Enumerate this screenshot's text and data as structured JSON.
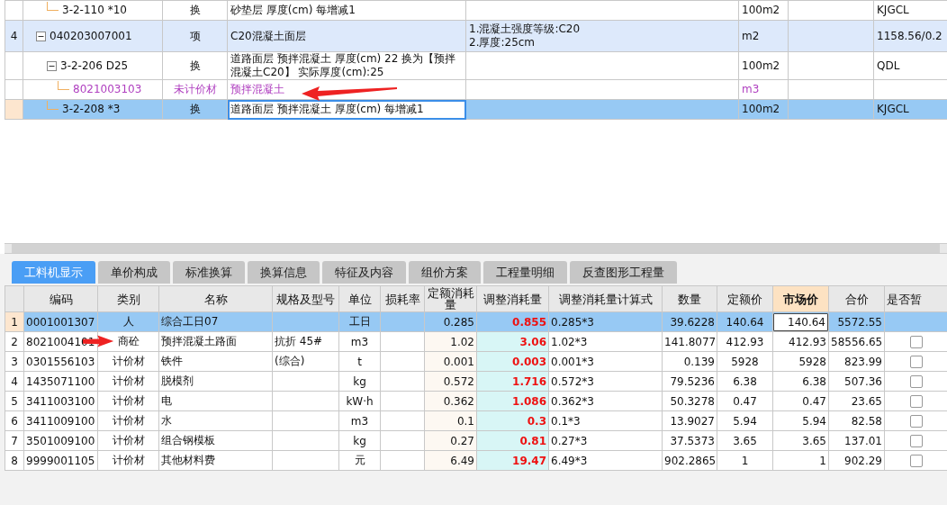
{
  "upper_grid": {
    "rows": [
      {
        "kind": "quota",
        "code": "3-2-110 *10",
        "type": "换",
        "name": "砂垫层 厚度(cm) 每增减1",
        "unit": "100m2",
        "column_8": "KJGCL",
        "selected": false
      },
      {
        "kind": "item",
        "number": "4",
        "code": "040203007001",
        "type": "项",
        "name": "C20混凝土面层",
        "features": [
          "1.混凝土强度等级:C20",
          "2.厚度:25cm"
        ],
        "unit": "m2",
        "column_8": "1158.56/0.2",
        "expanded": true,
        "selected": false,
        "children": [
          {
            "kind": "quota",
            "code": "3-2-206 D25",
            "type": "换",
            "name": "道路面层 预拌混凝土 厚度(cm) 22  换为【预拌混凝土C20】  实际厚度(cm):25",
            "unit": "100m2",
            "column_8": "QDL",
            "expanded": true,
            "selected": false,
            "children": [
              {
                "kind": "material",
                "code": "8021003103",
                "type": "未计价材",
                "name": "预拌混凝土",
                "unit": "m3",
                "selected": false
              }
            ]
          },
          {
            "kind": "quota",
            "code": "3-2-208 *3",
            "type": "换",
            "name": "道路面层 预拌混凝土 厚度(cm) 每增减1",
            "unit": "100m2",
            "column_8": "KJGCL",
            "selected": true
          }
        ]
      }
    ]
  },
  "tabs": [
    {
      "label": "工料机显示",
      "selected": true
    },
    {
      "label": "单价构成",
      "selected": false
    },
    {
      "label": "标准换算",
      "selected": false
    },
    {
      "label": "换算信息",
      "selected": false
    },
    {
      "label": "特征及内容",
      "selected": false
    },
    {
      "label": "组价方案",
      "selected": false
    },
    {
      "label": "工程量明细",
      "selected": false
    },
    {
      "label": "反查图形工程量",
      "selected": false
    }
  ],
  "lower_grid": {
    "columns": [
      {
        "label": "编码",
        "selected": false
      },
      {
        "label": "类别",
        "selected": false
      },
      {
        "label": "名称",
        "selected": false
      },
      {
        "label": "规格及型号",
        "selected": false
      },
      {
        "label": "单位",
        "selected": false
      },
      {
        "label": "损耗率",
        "selected": false
      },
      {
        "label": "定额消耗量",
        "selected": false
      },
      {
        "label": "调整消耗量",
        "selected": false
      },
      {
        "label": "调整消耗量计算式",
        "selected": false
      },
      {
        "label": "数量",
        "selected": false
      },
      {
        "label": "定额价",
        "selected": false
      },
      {
        "label": "市场价",
        "selected": true
      },
      {
        "label": "合价",
        "selected": false
      },
      {
        "label": "是否暂",
        "selected": false
      }
    ],
    "rows": [
      {
        "number": "1",
        "code": "0001001307",
        "type": "人",
        "name": "综合工日07",
        "unit": "工日",
        "quota_qty": "0.285",
        "adjusted_qty": "0.855",
        "formula": "0.285*3",
        "quantity": "39.6228",
        "quota_price": "140.64",
        "market_price": "140.64",
        "total": "5572.55",
        "selected": true
      },
      {
        "number": "2",
        "code": "8021004101",
        "type": "商砼",
        "name": "预拌混凝土路面",
        "spec": "抗折 45#",
        "unit": "m3",
        "quota_qty": "1.02",
        "adjusted_qty": "3.06",
        "formula": "1.02*3",
        "quantity": "141.8077",
        "quota_price": "412.93",
        "market_price": "412.93",
        "total": "58556.65",
        "checked": false,
        "selected": false
      },
      {
        "number": "3",
        "code": "0301556103",
        "type": "计价材",
        "name": "铁件",
        "spec": "(综合)",
        "unit": "t",
        "quota_qty": "0.001",
        "adjusted_qty": "0.003",
        "formula": "0.001*3",
        "quantity": "0.139",
        "quota_price": "5928",
        "market_price": "5928",
        "total": "823.99",
        "checked": false,
        "selected": false
      },
      {
        "number": "4",
        "code": "1435071100",
        "type": "计价材",
        "name": "脱模剂",
        "unit": "kg",
        "quota_qty": "0.572",
        "adjusted_qty": "1.716",
        "formula": "0.572*3",
        "quantity": "79.5236",
        "quota_price": "6.38",
        "market_price": "6.38",
        "total": "507.36",
        "checked": false,
        "selected": false
      },
      {
        "number": "5",
        "code": "3411003100",
        "type": "计价材",
        "name": "电",
        "unit": "kW·h",
        "quota_qty": "0.362",
        "adjusted_qty": "1.086",
        "formula": "0.362*3",
        "quantity": "50.3278",
        "quota_price": "0.47",
        "market_price": "0.47",
        "total": "23.65",
        "checked": false,
        "selected": false
      },
      {
        "number": "6",
        "code": "3411009100",
        "type": "计价材",
        "name": "水",
        "unit": "m3",
        "quota_qty": "0.1",
        "adjusted_qty": "0.3",
        "formula": "0.1*3",
        "quantity": "13.9027",
        "quota_price": "5.94",
        "market_price": "5.94",
        "total": "82.58",
        "checked": false,
        "selected": false
      },
      {
        "number": "7",
        "code": "3501009100",
        "type": "计价材",
        "name": "组合钢模板",
        "unit": "kg",
        "quota_qty": "0.27",
        "adjusted_qty": "0.81",
        "formula": "0.27*3",
        "quantity": "37.5373",
        "quota_price": "3.65",
        "market_price": "3.65",
        "total": "137.01",
        "checked": false,
        "selected": false
      },
      {
        "number": "8",
        "code": "9999001105",
        "type": "计价材",
        "name": "其他材料费",
        "unit": "元",
        "quota_qty": "6.49",
        "adjusted_qty": "19.47",
        "formula": "6.49*3",
        "quantity": "902.2865",
        "quota_price": "1",
        "market_price": "1",
        "total": "902.29",
        "checked": false,
        "selected": false
      }
    ]
  }
}
